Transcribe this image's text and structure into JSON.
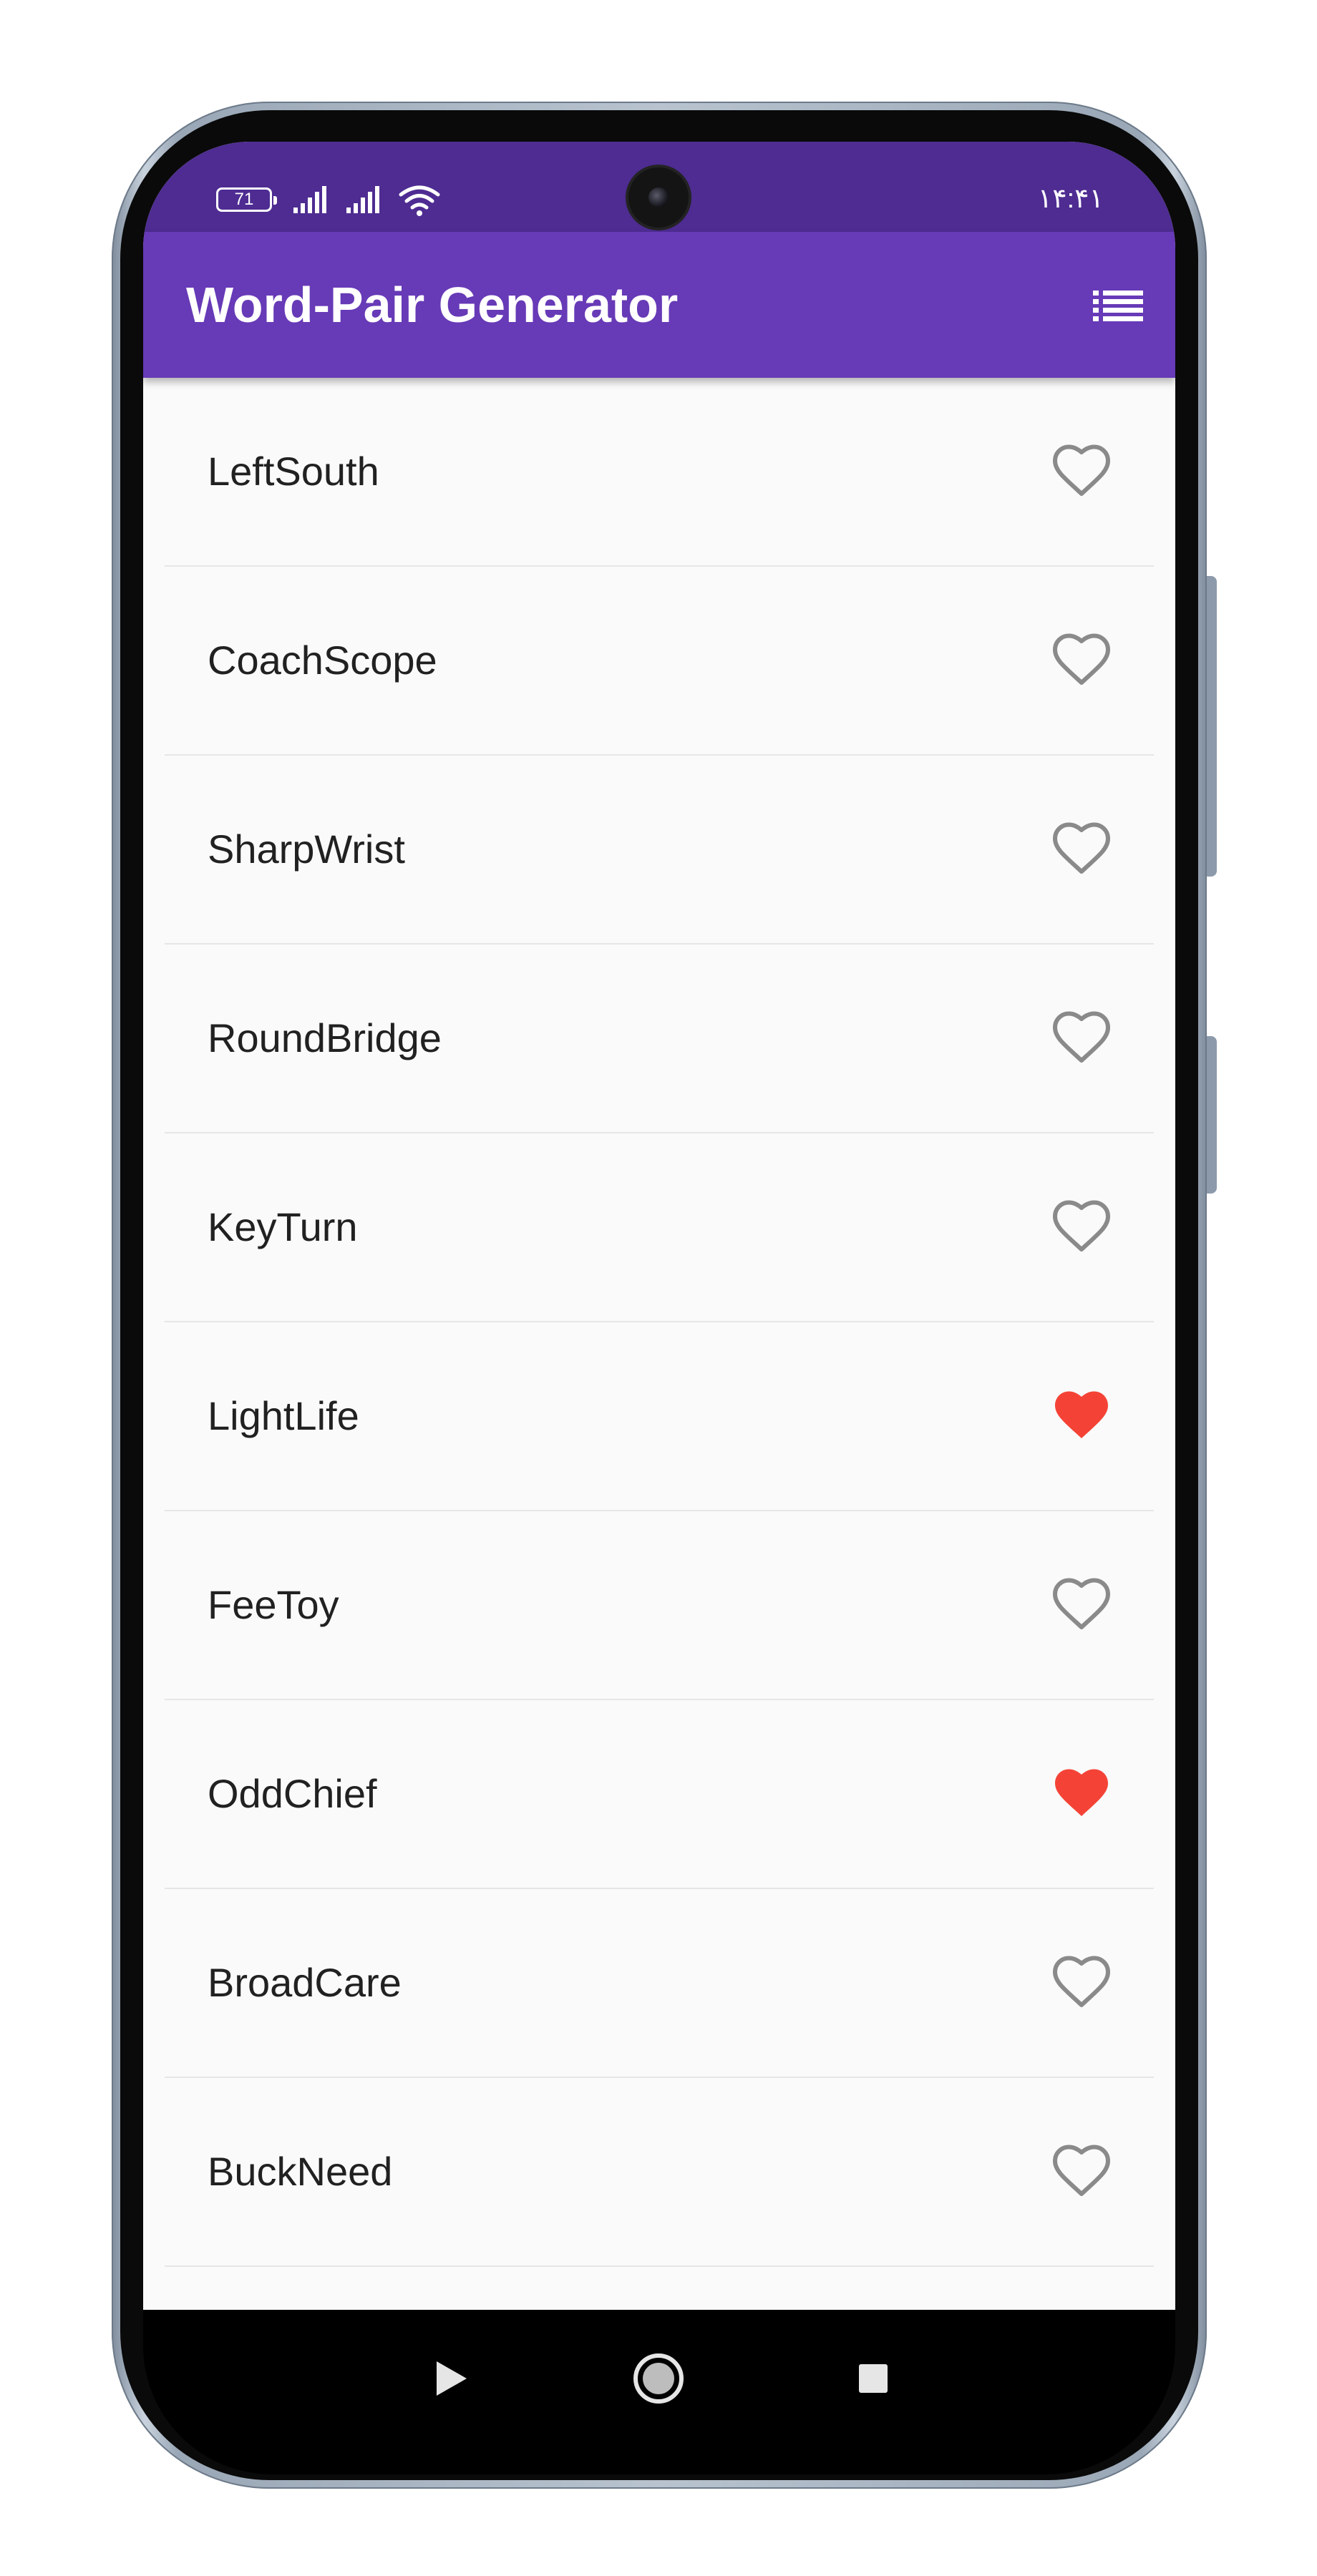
{
  "status_bar": {
    "battery": "71",
    "time": "۱۴:۴۱"
  },
  "app_bar": {
    "title": "Word-Pair Generator",
    "action_icon": "list-icon"
  },
  "word_pairs": [
    {
      "label": "LeftSouth",
      "favorite": false
    },
    {
      "label": "CoachScope",
      "favorite": false
    },
    {
      "label": "SharpWrist",
      "favorite": false
    },
    {
      "label": "RoundBridge",
      "favorite": false
    },
    {
      "label": "KeyTurn",
      "favorite": false
    },
    {
      "label": "LightLife",
      "favorite": true
    },
    {
      "label": "FeeToy",
      "favorite": false
    },
    {
      "label": "OddChief",
      "favorite": true
    },
    {
      "label": "BroadCare",
      "favorite": false
    },
    {
      "label": "BuckNeed",
      "favorite": false
    }
  ],
  "colors": {
    "app_bar": "#673ab7",
    "status_bar": "#4e2c92",
    "favorite_heart": "#f44336",
    "outline_heart": "#8a8a8a"
  },
  "nav_bar": {
    "icons": [
      "back-triangle-icon",
      "home-circle-icon",
      "recents-square-icon"
    ]
  }
}
